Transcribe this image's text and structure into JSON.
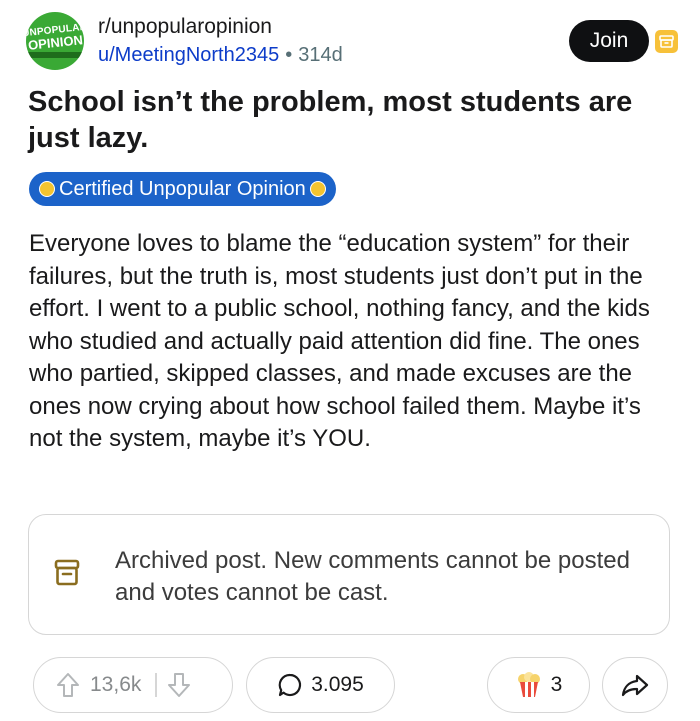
{
  "post": {
    "subreddit": "r/unpopularopinion",
    "subreddit_logo": {
      "line1": "UNPOPULAR",
      "line2": "OPINION"
    },
    "author": "u/MeetingNorth2345",
    "age": "314d",
    "join_label": "Join",
    "title": "School isn’t the problem, most students are just lazy.",
    "flair": "Certified Unpopular Opinion",
    "body": "Everyone loves to blame the “education system” for their failures, but the truth is, most students just don’t put in the effort. I went to a public school, nothing fancy, and the kids who studied and actually paid attention did fine. The ones who partied, skipped classes, and made excuses are the ones now crying about how school failed them. Maybe it’s not the system, maybe it’s YOU.",
    "archived_message": "Archived post. New comments cannot be posted and votes cannot be cast."
  },
  "actions": {
    "upvotes": "13,6k",
    "comments": "3.095",
    "awards": "3"
  },
  "colors": {
    "author_link": "#0d3cc9",
    "flair_bg": "#1c63c9",
    "join_bg": "#0f1012",
    "archive_badge": "#f7c13a",
    "subreddit_logo": "#3aa935"
  },
  "icons": {
    "upvote": "arrow-up-icon",
    "downvote": "arrow-down-icon",
    "comment": "speech-bubble-icon",
    "award": "popcorn-award-icon",
    "share": "share-arrow-icon",
    "archived": "archive-box-icon"
  }
}
